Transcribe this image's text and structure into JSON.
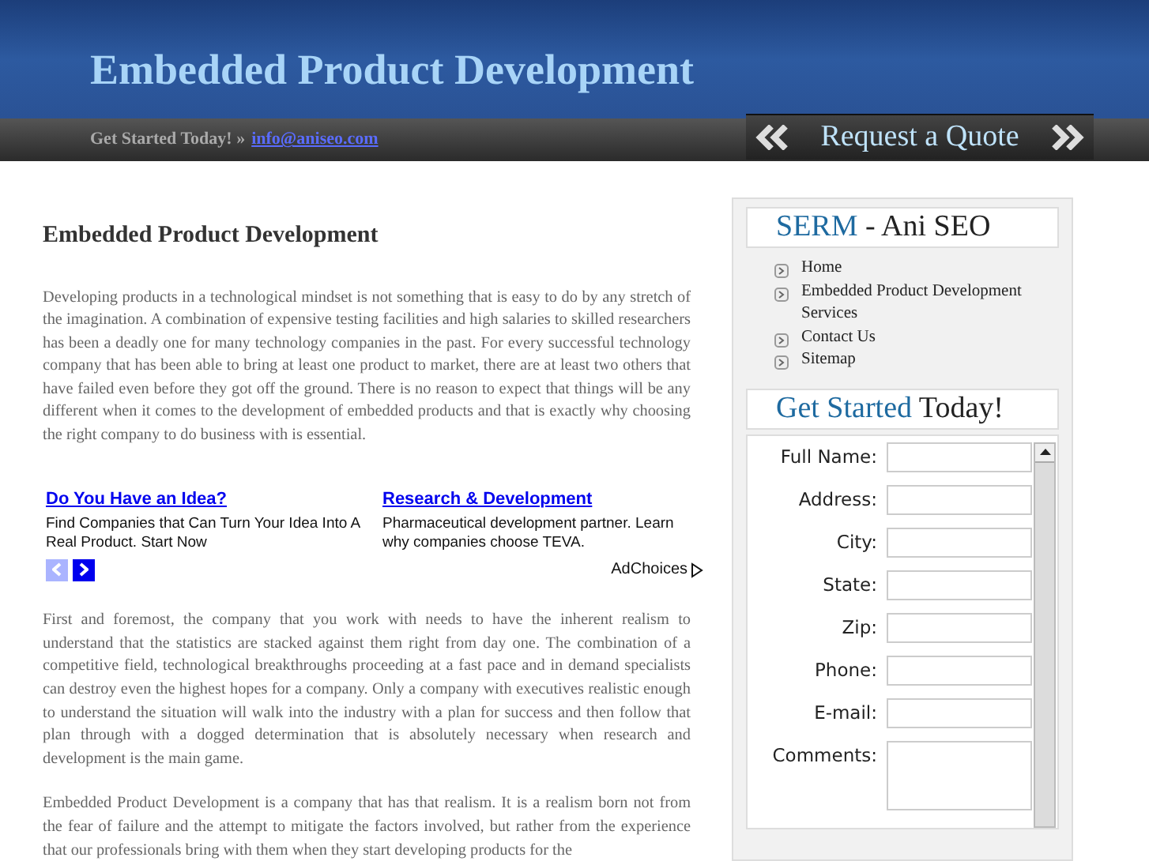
{
  "header": {
    "title": "Embedded Product Development"
  },
  "top_bar": {
    "text": "Get Started Today! »",
    "email_link": "info@aniseo.com",
    "quote_button": "Request a Quote"
  },
  "article": {
    "heading": "Embedded Product Development",
    "paragraphs_before_ads": [
      "Developing products in a technological mindset is not something that is easy to do by any stretch of the imagination. A combination of expensive testing facilities and high salaries to skilled researchers has been a deadly one for many technology companies in the past. For every successful technology company that has been able to bring at least one product to market, there are at least two others that have failed even before they got off the ground. There is no reason to expect that things will be any different when it comes to the development of embedded products and that is exactly why choosing the right company to do business with is essential."
    ],
    "ads": [
      {
        "title": "Do You Have an Idea?",
        "text": "Find Companies that Can Turn Your Idea Into A Real Product. Start Now"
      },
      {
        "title": "Research & Development",
        "text": "Pharmaceutical development partner. Learn why companies choose TEVA."
      }
    ],
    "ad_choices": "AdChoices",
    "paragraphs": [
      "First and foremost, the company that you work with needs to have the inherent realism to understand that the statistics are stacked against them right from day one. The combination of a competitive field, technological breakthroughs proceeding at a fast pace and in demand specialists can destroy even the highest hopes for a company. Only a company with executives realistic enough to understand the situation will walk into the industry with a plan for success and then follow that plan through with a dogged determination that is absolutely necessary when research and development is the main game.",
      "Embedded Product Development is a company that has that realism. It is a realism born not from the fear of failure and the attempt to mitigate the factors involved, but rather from the experience that our professionals bring with them when they start developing products for the"
    ]
  },
  "sidebar": {
    "nav_title": {
      "accent": "SERM",
      "rest": "- Ani SEO"
    },
    "nav_items": [
      "Home",
      "Embedded Product Development Services",
      "Contact Us",
      "Sitemap"
    ],
    "form_title": {
      "accent": "Get Started",
      "rest": "Today!"
    },
    "form_fields": [
      {
        "label": "Full Name:",
        "kind": "input"
      },
      {
        "label": "Address:",
        "kind": "input"
      },
      {
        "label": "City:",
        "kind": "input"
      },
      {
        "label": "State:",
        "kind": "input"
      },
      {
        "label": "Zip:",
        "kind": "input"
      },
      {
        "label": "Phone:",
        "kind": "input"
      },
      {
        "label": "E-mail:",
        "kind": "input"
      },
      {
        "label": "Comments:",
        "kind": "textarea"
      }
    ]
  }
}
